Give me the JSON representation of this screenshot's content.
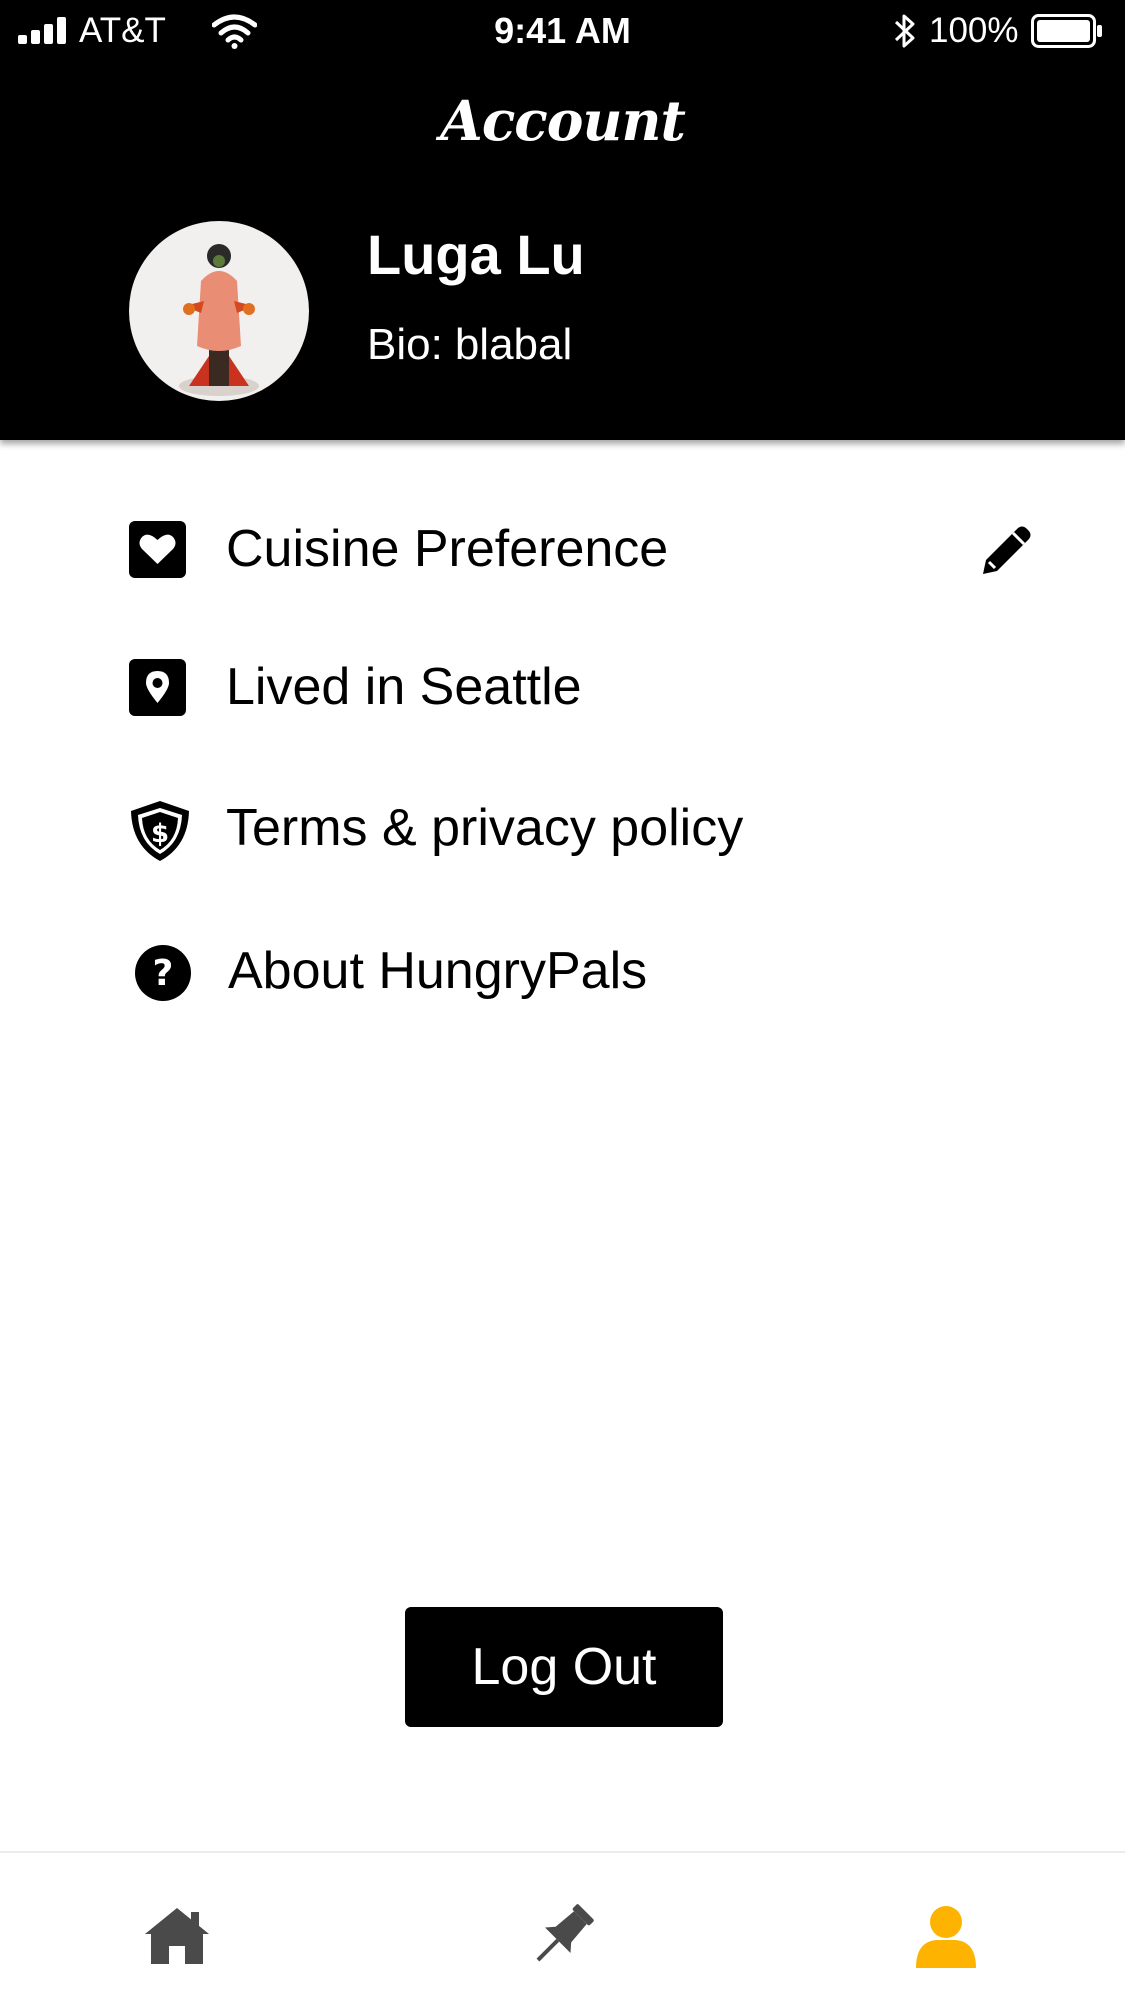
{
  "status_bar": {
    "carrier": "AT&T",
    "time": "9:41 AM",
    "battery_percent": "100%",
    "icons": [
      "signal-icon",
      "wifi-icon",
      "bluetooth-icon",
      "battery-icon"
    ]
  },
  "header": {
    "title": "Account"
  },
  "profile": {
    "name": "Luga Lu",
    "bio_label": "Bio:",
    "bio_value": "blabal"
  },
  "menu": {
    "items": [
      {
        "label": "Cuisine Preference",
        "icon": "heart-icon"
      },
      {
        "label": "Lived in Seattle",
        "icon": "location-pin-icon"
      },
      {
        "label": "Terms & privacy policy",
        "icon": "shield-dollar-icon"
      },
      {
        "label": "About HungryPals",
        "icon": "question-circle-icon"
      }
    ],
    "edit_icon": "pencil-icon"
  },
  "logout_label": "Log Out",
  "tabs": [
    {
      "icon": "home-icon",
      "active": false
    },
    {
      "icon": "pin-icon",
      "active": false
    },
    {
      "icon": "user-icon",
      "active": true
    }
  ],
  "colors": {
    "header_bg": "#000000",
    "active_tab": "#FDB300",
    "inactive_tab": "#4A4A4A",
    "button_bg": "#000000"
  }
}
